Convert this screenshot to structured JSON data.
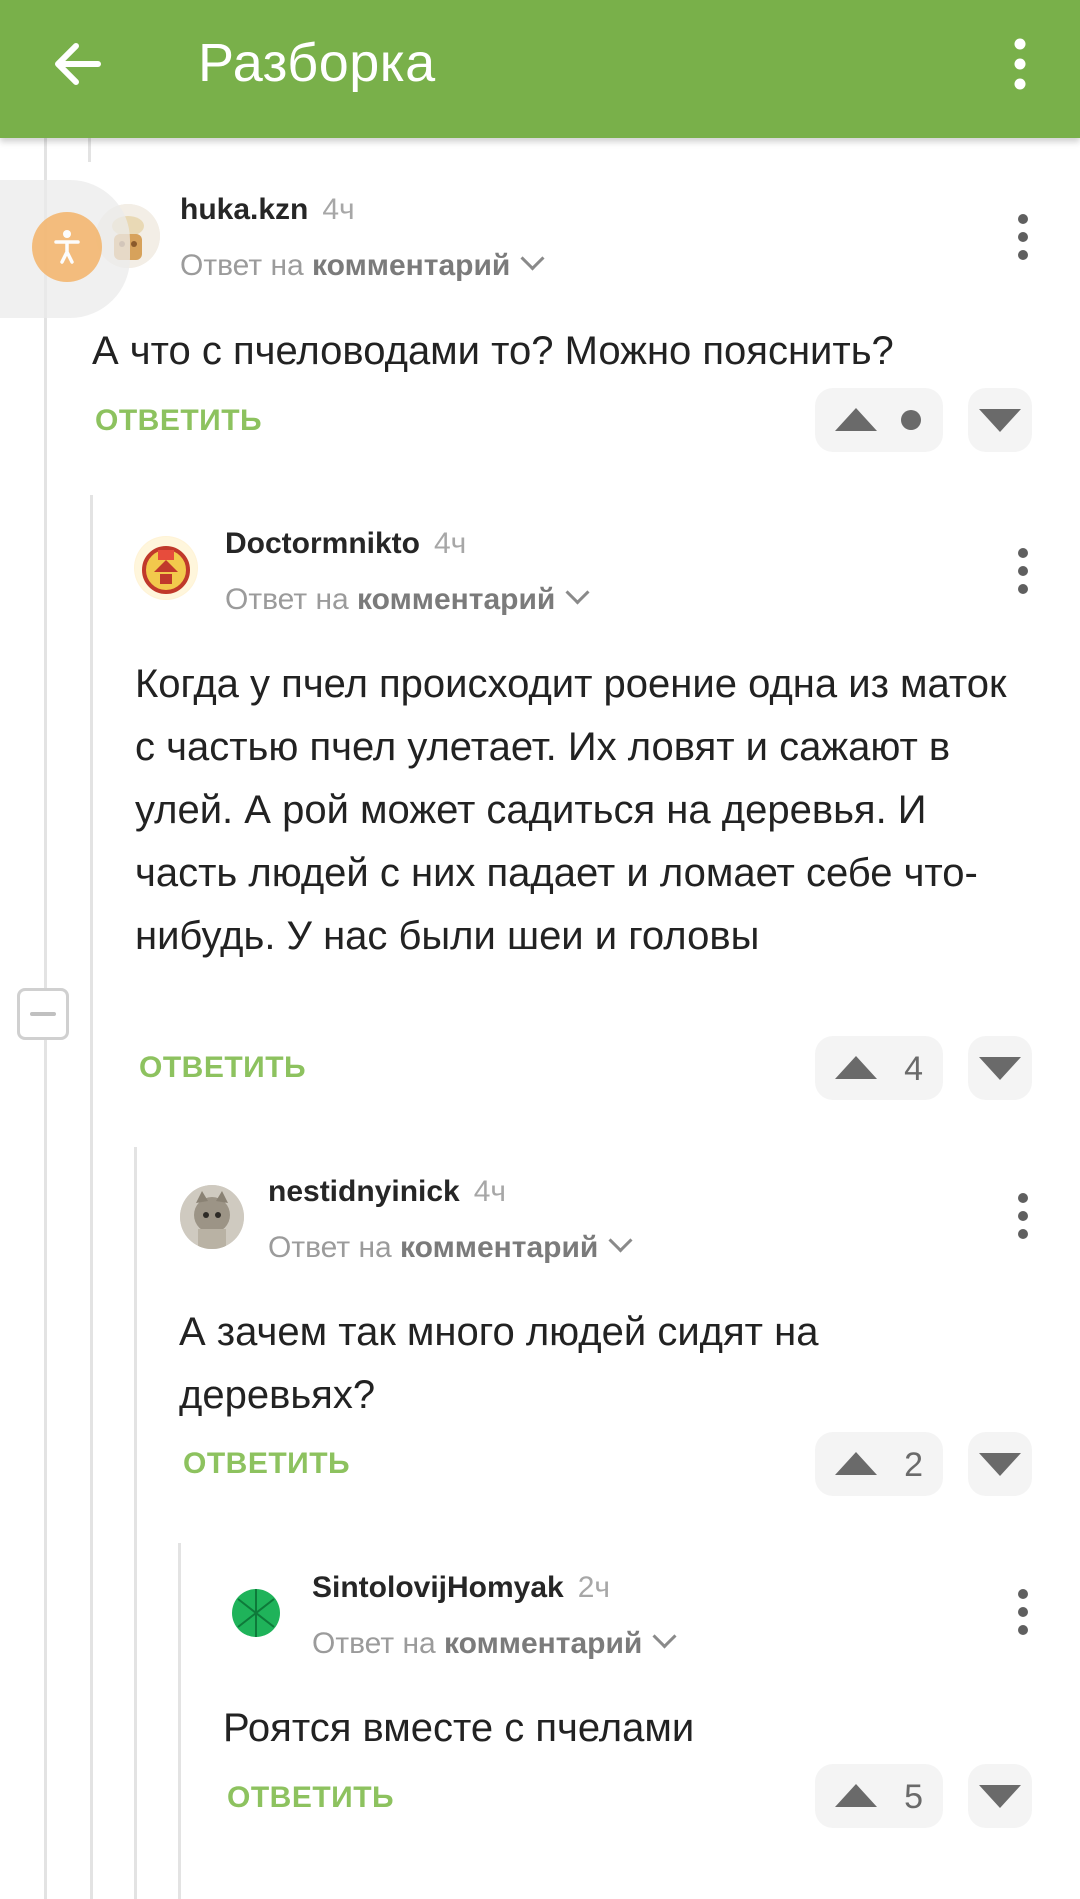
{
  "appbar": {
    "title": "Разборка",
    "back_icon": "arrow-back-icon",
    "menu_icon": "more-vert-icon",
    "color": "#79b04a"
  },
  "accent_color": "#8dc25f",
  "comments": [
    {
      "author": "huka.kzn",
      "time": "4ч",
      "reply_prefix": "Ответ на",
      "reply_target": "комментарий",
      "text": "А что с пчеловодами то? Можно пояснить?",
      "reply_label": "ОТВЕТИТЬ",
      "score": "",
      "score_hidden": true
    },
    {
      "author": "Doctormnikto",
      "time": "4ч",
      "reply_prefix": "Ответ на",
      "reply_target": "комментарий",
      "text": "Когда у пчел происходит роение одна из маток с частью пчел улетает. Их ловят и сажают в улей. А рой может садиться на деревья. И часть людей с них падает и ломает себе что-нибудь. У нас были шеи и головы",
      "reply_label": "ОТВЕТИТЬ",
      "score": "4"
    },
    {
      "author": "nestidnyinick",
      "time": "4ч",
      "reply_prefix": "Ответ на",
      "reply_target": "комментарий",
      "text": "А зачем так много людей сидят на деревьях?",
      "reply_label": "ОТВЕТИТЬ",
      "score": "2"
    },
    {
      "author": "SintolovijHomyak",
      "time": "2ч",
      "reply_prefix": "Ответ на",
      "reply_target": "комментарий",
      "text": "Роятся вместе с пчелами",
      "reply_label": "ОТВЕТИТЬ",
      "score": "5"
    }
  ]
}
